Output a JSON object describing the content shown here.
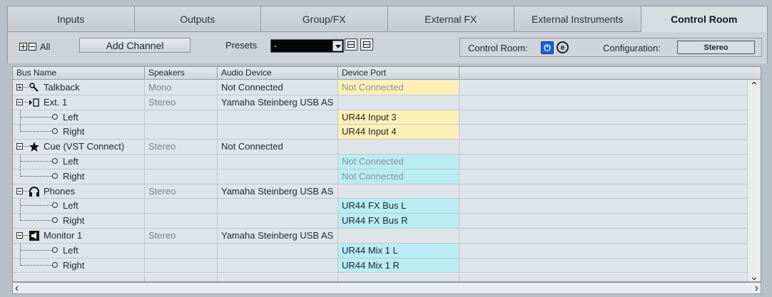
{
  "tabs": [
    "Inputs",
    "Outputs",
    "Group/FX",
    "External FX",
    "External Instruments",
    "Control Room"
  ],
  "active_tab": "Control Room",
  "toolbar": {
    "all_label": "All",
    "add_channel": "Add Channel",
    "presets_label": "Presets",
    "preset_value": "-",
    "control_room_label": "Control Room:",
    "configuration_label": "Configuration:",
    "configuration_value": "Stereo"
  },
  "columns": [
    "Bus Name",
    "Speakers",
    "Audio Device",
    "Device Port"
  ],
  "rows": [
    {
      "level": 0,
      "name": "Talkback",
      "icon": "microphone-icon",
      "speakers": "Mono",
      "device": "Not Connected",
      "port": "Not Connected",
      "port_style": "yellow-nc",
      "toggle": "plus"
    },
    {
      "level": 0,
      "name": "Ext. 1",
      "icon": "external-icon",
      "speakers": "Stereo",
      "device": "Yamaha Steinberg USB AS",
      "port": "",
      "port_style": "",
      "toggle": "minus"
    },
    {
      "level": 1,
      "name": "Left",
      "speakers": "",
      "device": "",
      "port": "UR44 Input 3",
      "port_style": "yellow"
    },
    {
      "level": 1,
      "name": "Right",
      "speakers": "",
      "device": "",
      "port": "UR44 Input 4",
      "port_style": "yellow",
      "last": true
    },
    {
      "level": 0,
      "name": "Cue (VST Connect)",
      "icon": "star-icon",
      "speakers": "Stereo",
      "device": "Not Connected",
      "port": "",
      "port_style": "",
      "toggle": "minus"
    },
    {
      "level": 1,
      "name": "Left",
      "speakers": "",
      "device": "",
      "port": "Not Connected",
      "port_style": "cyan-nc"
    },
    {
      "level": 1,
      "name": "Right",
      "speakers": "",
      "device": "",
      "port": "Not Connected",
      "port_style": "cyan-nc",
      "last": true
    },
    {
      "level": 0,
      "name": "Phones",
      "icon": "headphones-icon",
      "speakers": "Stereo",
      "device": "Yamaha Steinberg USB AS",
      "port": "",
      "port_style": "",
      "toggle": "minus"
    },
    {
      "level": 1,
      "name": "Left",
      "speakers": "",
      "device": "",
      "port": "UR44 FX Bus L",
      "port_style": "cyan"
    },
    {
      "level": 1,
      "name": "Right",
      "speakers": "",
      "device": "",
      "port": "UR44 FX Bus R",
      "port_style": "cyan",
      "last": true
    },
    {
      "level": 0,
      "name": "Monitor 1",
      "icon": "speaker-icon",
      "speakers": "Stereo",
      "device": "Yamaha Steinberg USB AS",
      "port": "",
      "port_style": "",
      "toggle": "minus"
    },
    {
      "level": 1,
      "name": "Left",
      "speakers": "",
      "device": "",
      "port": "UR44 Mix 1 L",
      "port_style": "cyan"
    },
    {
      "level": 1,
      "name": "Right",
      "speakers": "",
      "device": "",
      "port": "UR44 Mix 1 R",
      "port_style": "cyan",
      "last": true
    },
    {
      "level": -1,
      "name": "",
      "speakers": "",
      "device": "",
      "port": "",
      "port_style": ""
    }
  ]
}
